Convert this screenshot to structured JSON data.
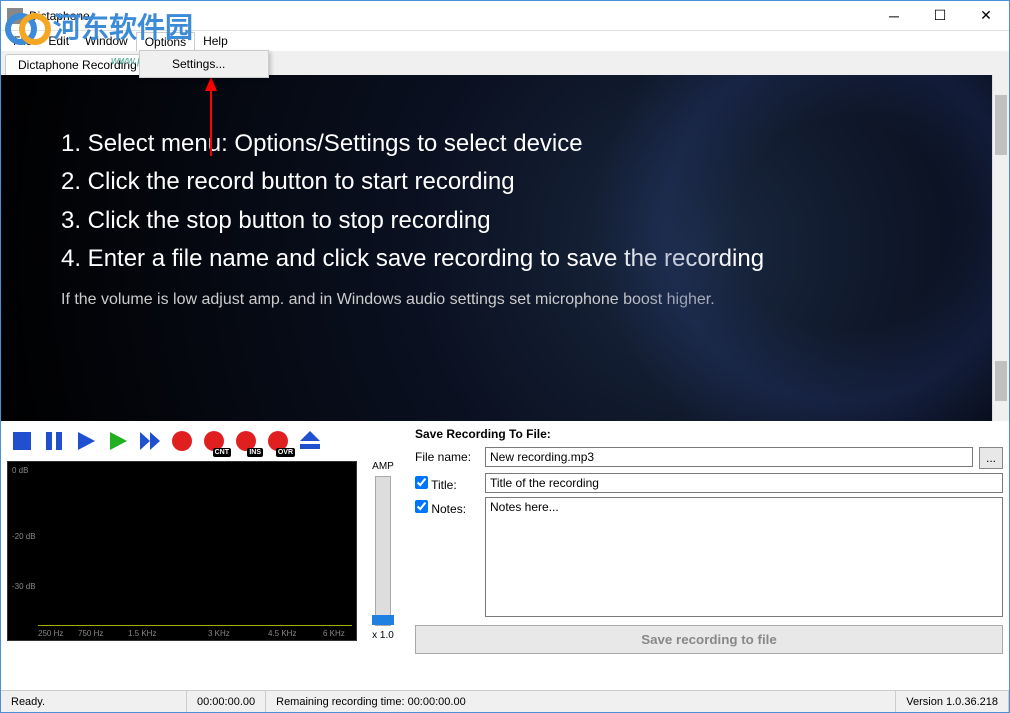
{
  "window": {
    "title": "Dictaphone"
  },
  "watermark": {
    "text": "河东软件园",
    "sub": "www.pc0359.cn"
  },
  "menu": {
    "file": "File",
    "edit": "Edit",
    "window": "Window",
    "options": "Options",
    "help": "Help",
    "dropdown": {
      "settings": "Settings..."
    }
  },
  "tabs": {
    "recording": "Dictaphone Recording"
  },
  "instructions": {
    "step1": "1. Select menu: Options/Settings to select device",
    "step2": "2. Click the record button to start recording",
    "step3": "3. Click the stop button to stop recording",
    "step4": "4. Enter a file name and click save recording to save the recording",
    "hint": "If the volume is low adjust amp. and in Windows audio settings set microphone boost higher."
  },
  "transport": {
    "badge_cnt": "CNT",
    "badge_ins": "INS",
    "badge_ovr": "OVR"
  },
  "spectrum": {
    "y0": "0 dB",
    "y1": "-20 dB",
    "y2": "-30 dB",
    "x0": "250 Hz",
    "x1": "750 Hz",
    "x2": "1.5 KHz",
    "x3": "3 KHz",
    "x4": "4.5 KHz",
    "x5": "6 KHz"
  },
  "amp": {
    "label": "AMP",
    "value": "x 1.0"
  },
  "save": {
    "heading": "Save Recording To File:",
    "filename_label": "File name:",
    "filename_value": "New recording.mp3",
    "title_label": "Title:",
    "title_value": "Title of the recording",
    "notes_label": "Notes:",
    "notes_value": "Notes here...",
    "button": "Save recording to file",
    "browse": "..."
  },
  "status": {
    "ready": "Ready.",
    "time1": "00:00:00.00",
    "remaining": "Remaining recording time: 00:00:00.00",
    "version": "Version 1.0.36.218"
  }
}
